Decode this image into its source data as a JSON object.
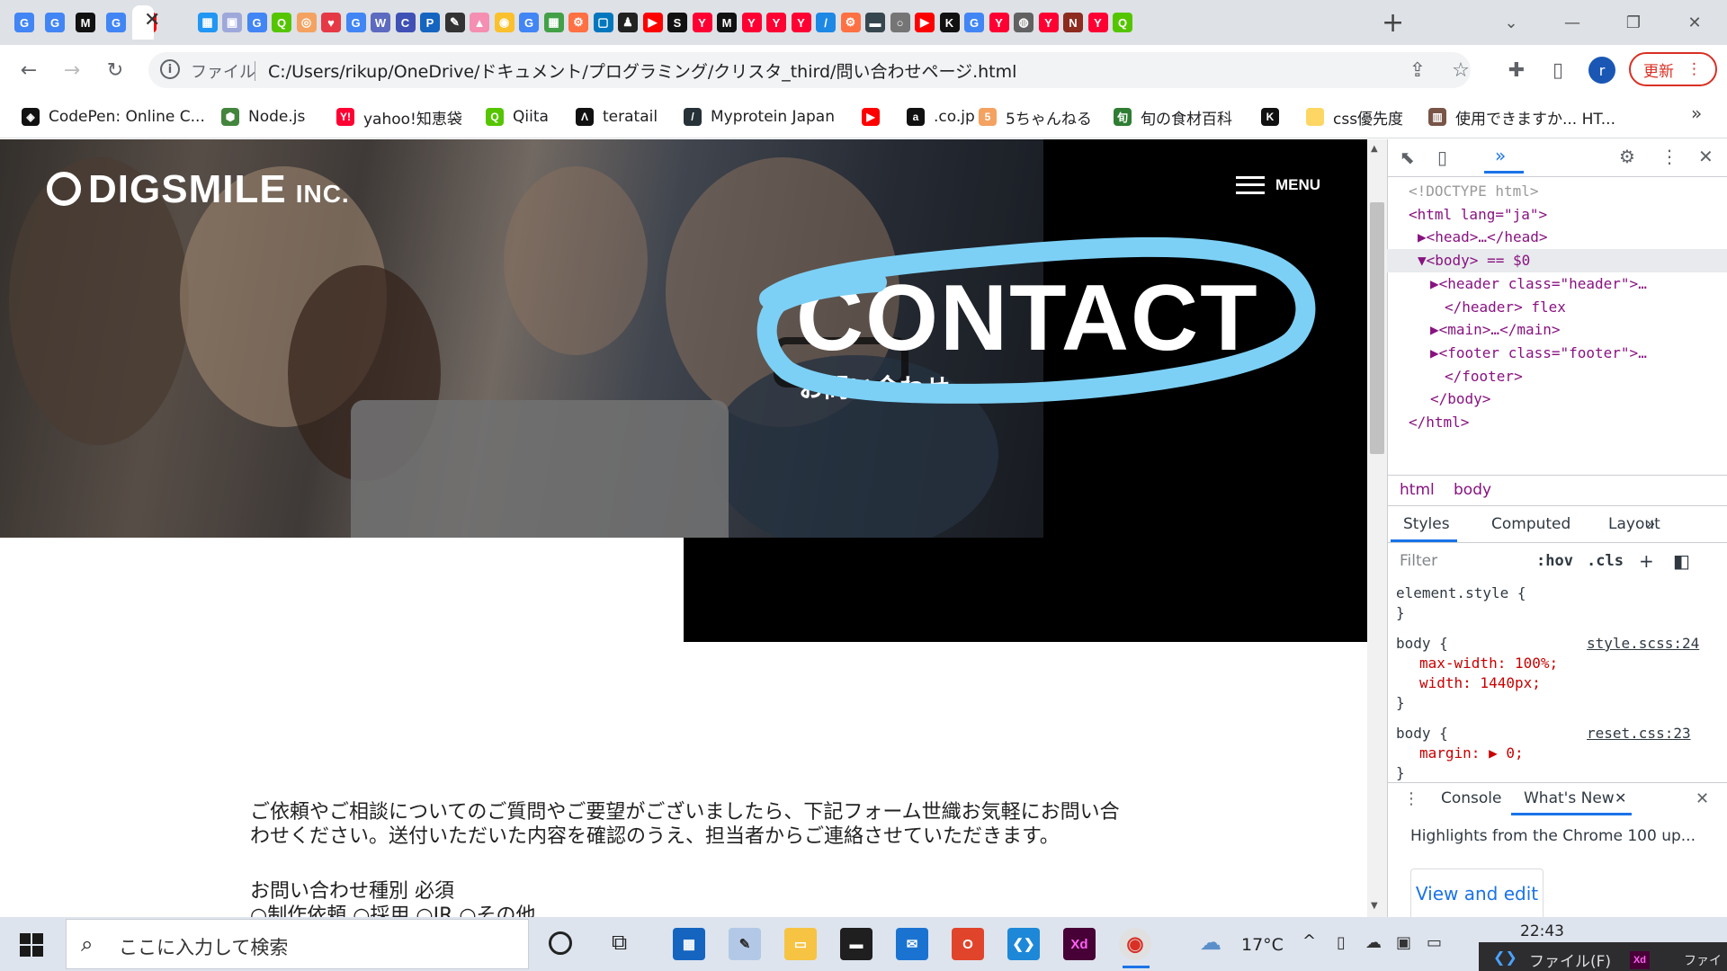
{
  "browser": {
    "address_label": "ファイル",
    "url": "C:/Users/rikup/OneDrive/ドキュメント/プログラミング/クリスタ_third/問い合わせページ.html",
    "update_label": "更新",
    "avatar_initial": "r",
    "new_tab": "+",
    "close_tab": "✕",
    "tab_favicons": [
      {
        "g": "G",
        "c": "#4285f4"
      },
      {
        "g": "G",
        "c": "#4285f4"
      },
      {
        "g": "M",
        "c": "#111111"
      },
      {
        "g": "G",
        "c": "#4285f4"
      },
      {
        "g": "▶",
        "c": "#ff0000"
      },
      {
        "g": "▦",
        "c": "#2196f3"
      },
      {
        "g": "▣",
        "c": "#9fa8da"
      },
      {
        "g": "G",
        "c": "#4285f4"
      },
      {
        "g": "Q",
        "c": "#55c500"
      },
      {
        "g": "◎",
        "c": "#f4a261"
      },
      {
        "g": "♥",
        "c": "#e63946"
      },
      {
        "g": "G",
        "c": "#4285f4"
      },
      {
        "g": "W",
        "c": "#5c6bc0"
      },
      {
        "g": "C",
        "c": "#3f51b5"
      },
      {
        "g": "P",
        "c": "#1565c0"
      },
      {
        "g": "✎",
        "c": "#333333"
      },
      {
        "g": "▲",
        "c": "#f48fb1"
      },
      {
        "g": "◉",
        "c": "#fbc02d"
      },
      {
        "g": "G",
        "c": "#4285f4"
      },
      {
        "g": "▦",
        "c": "#43a047"
      },
      {
        "g": "⚙",
        "c": "#ff7043"
      },
      {
        "g": "▢",
        "c": "#0277bd"
      },
      {
        "g": "♟",
        "c": "#222222"
      },
      {
        "g": "▶",
        "c": "#ff0000"
      },
      {
        "g": "S",
        "c": "#111111"
      },
      {
        "g": "Y",
        "c": "#ff0033"
      },
      {
        "g": "M",
        "c": "#111111"
      },
      {
        "g": "Y",
        "c": "#ff0033"
      },
      {
        "g": "Y",
        "c": "#ff0033"
      },
      {
        "g": "Y",
        "c": "#ff0033"
      },
      {
        "g": "/",
        "c": "#1e88e5"
      },
      {
        "g": "⚙",
        "c": "#ff7043"
      },
      {
        "g": "▬",
        "c": "#37474f"
      },
      {
        "g": "○",
        "c": "#757575"
      },
      {
        "g": "▶",
        "c": "#ff0000"
      },
      {
        "g": "K",
        "c": "#111111"
      },
      {
        "g": "G",
        "c": "#4285f4"
      },
      {
        "g": "Y",
        "c": "#ff0033"
      },
      {
        "g": "◍",
        "c": "#616161"
      },
      {
        "g": "Y",
        "c": "#ff0033"
      },
      {
        "g": "N",
        "c": "#8d2b1f"
      },
      {
        "g": "Y",
        "c": "#ff0033"
      },
      {
        "g": "Q",
        "c": "#55c500"
      }
    ]
  },
  "bookmarks": [
    {
      "label": "CodePen: Online C...",
      "icon": "codepen-icon",
      "glyph": "◈",
      "color": "#111111"
    },
    {
      "label": "Node.js",
      "icon": "nodejs-icon",
      "glyph": "⬢",
      "color": "#43853d"
    },
    {
      "label": "yahoo!知恵袋",
      "icon": "yahoo-icon",
      "glyph": "Y!",
      "color": "#ff0033"
    },
    {
      "label": "Qiita",
      "icon": "qiita-icon",
      "glyph": "Q",
      "color": "#55c500"
    },
    {
      "label": "teratail",
      "icon": "teratail-icon",
      "glyph": "Λ",
      "color": "#111111"
    },
    {
      "label": "Myprotein Japan",
      "icon": "myprotein-icon",
      "glyph": "/",
      "color": "#263238"
    },
    {
      "label": "",
      "icon": "youtube-icon",
      "glyph": "▶",
      "color": "#ff0000"
    },
    {
      "label": ".co.jp",
      "icon": "amazon-icon",
      "glyph": "a",
      "color": "#111111"
    },
    {
      "label": "5ちゃんねる",
      "icon": "5ch-icon",
      "glyph": "5",
      "color": "#f4a261"
    },
    {
      "label": "旬の食材百科",
      "icon": "syun-icon",
      "glyph": "旬",
      "color": "#2e7d32"
    },
    {
      "label": "",
      "icon": "k-icon",
      "glyph": "K",
      "color": "#111111"
    },
    {
      "label": "css優先度",
      "icon": "folder-icon",
      "glyph": "",
      "color": "#fdd663"
    },
    {
      "label": "使用できますか... HT...",
      "icon": "caniuse-icon",
      "glyph": "▥",
      "color": "#795548"
    }
  ],
  "site": {
    "logo_text": "DIGSMILE",
    "logo_suffix": "INC.",
    "menu_label": "MENU",
    "hero_title": "CONTACT",
    "hero_subtitle": "お問い合わせ",
    "intro_text": "ご依頼やご相談についてのご質問やご要望がございましたら、下記フォーム世織お気軽にお問い合わせください。送付いただいた内容を確認のうえ、担当者からご連絡させていただきます。",
    "category_label": "お問い合わせ種別 必須",
    "category_options": "○制作依頼 ○採用 ○IR ○その他"
  },
  "devtools": {
    "tabs_more": "»",
    "dom_lines": [
      {
        "t": "<!DOCTYPE html>",
        "c": "#999999"
      },
      {
        "t": "<html lang=\"ja\">",
        "c": "#881280"
      },
      {
        "t": "▶<head>…</head>",
        "c": "#881280"
      },
      {
        "t": "▼<body> == $0",
        "c": "#881280"
      },
      {
        "t": "▶<header class=\"header\">…",
        "c": "#881280"
      },
      {
        "t": "</header> flex",
        "c": "#881280"
      },
      {
        "t": "▶<main>…</main>",
        "c": "#881280"
      },
      {
        "t": "▶<footer class=\"footer\">…",
        "c": "#881280"
      },
      {
        "t": "</footer>",
        "c": "#881280"
      },
      {
        "t": "</body>",
        "c": "#881280"
      },
      {
        "t": "</html>",
        "c": "#881280"
      }
    ],
    "crumbs": [
      "html",
      "body"
    ],
    "panel_tabs": [
      "Styles",
      "Computed",
      "Layout",
      "»"
    ],
    "filter_placeholder": "Filter",
    "hov": ":hov",
    "cls": ".cls",
    "rules": [
      {
        "sel": "element.style {",
        "src": "",
        "props": [],
        "end": "}"
      },
      {
        "sel": "body {",
        "src": "style.scss:24",
        "props": [
          "max-width: 100%;",
          "width: 1440px;"
        ],
        "end": "}"
      },
      {
        "sel": "body {",
        "src": "reset.css:23",
        "props": [
          "margin: ▶ 0;"
        ],
        "end": "}"
      }
    ],
    "drawer_tabs": [
      "Console",
      "What's New"
    ],
    "drawer_headline": "Highlights from the Chrome 100 up...",
    "drawer_button": "View and edit"
  },
  "taskbar": {
    "search_placeholder": "ここに入力して検索",
    "weather": "17°C",
    "time": "22:43",
    "side_window": "ファイル(F)",
    "side_window2": "ファイ"
  },
  "colors": {
    "hero_black": "#000000",
    "scribble": "#7dd0f5",
    "accent_red": "#d93025"
  }
}
